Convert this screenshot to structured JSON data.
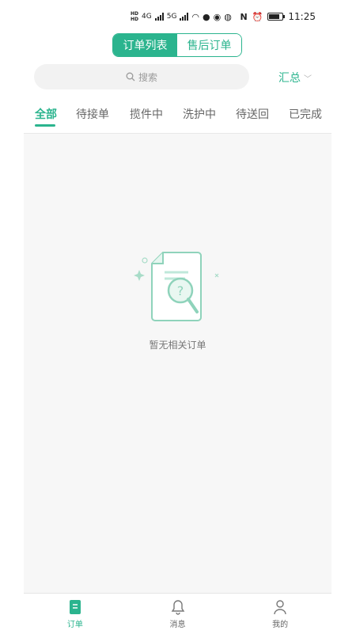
{
  "status_bar": {
    "hd_top": "HD",
    "hd_bottom": "HD",
    "net1": "4G",
    "net2": "5G",
    "nfc": "N",
    "time": "11:25"
  },
  "header": {
    "segments": [
      {
        "label": "订单列表",
        "active": true
      },
      {
        "label": "售后订单",
        "active": false
      }
    ]
  },
  "search": {
    "placeholder": "搜索"
  },
  "summary": {
    "label": "汇总"
  },
  "tabs": [
    {
      "label": "全部",
      "active": true
    },
    {
      "label": "待接单",
      "active": false
    },
    {
      "label": "揽件中",
      "active": false
    },
    {
      "label": "洗护中",
      "active": false
    },
    {
      "label": "待送回",
      "active": false
    },
    {
      "label": "已完成",
      "active": false
    }
  ],
  "empty_state": {
    "message": "暂无相关订单"
  },
  "bottom_nav": [
    {
      "label": "订单",
      "icon": "order-icon",
      "active": true
    },
    {
      "label": "消息",
      "icon": "bell-icon",
      "active": false
    },
    {
      "label": "我的",
      "icon": "person-icon",
      "active": false
    }
  ],
  "colors": {
    "accent": "#2bb48e",
    "background": "#f7f7f7"
  }
}
